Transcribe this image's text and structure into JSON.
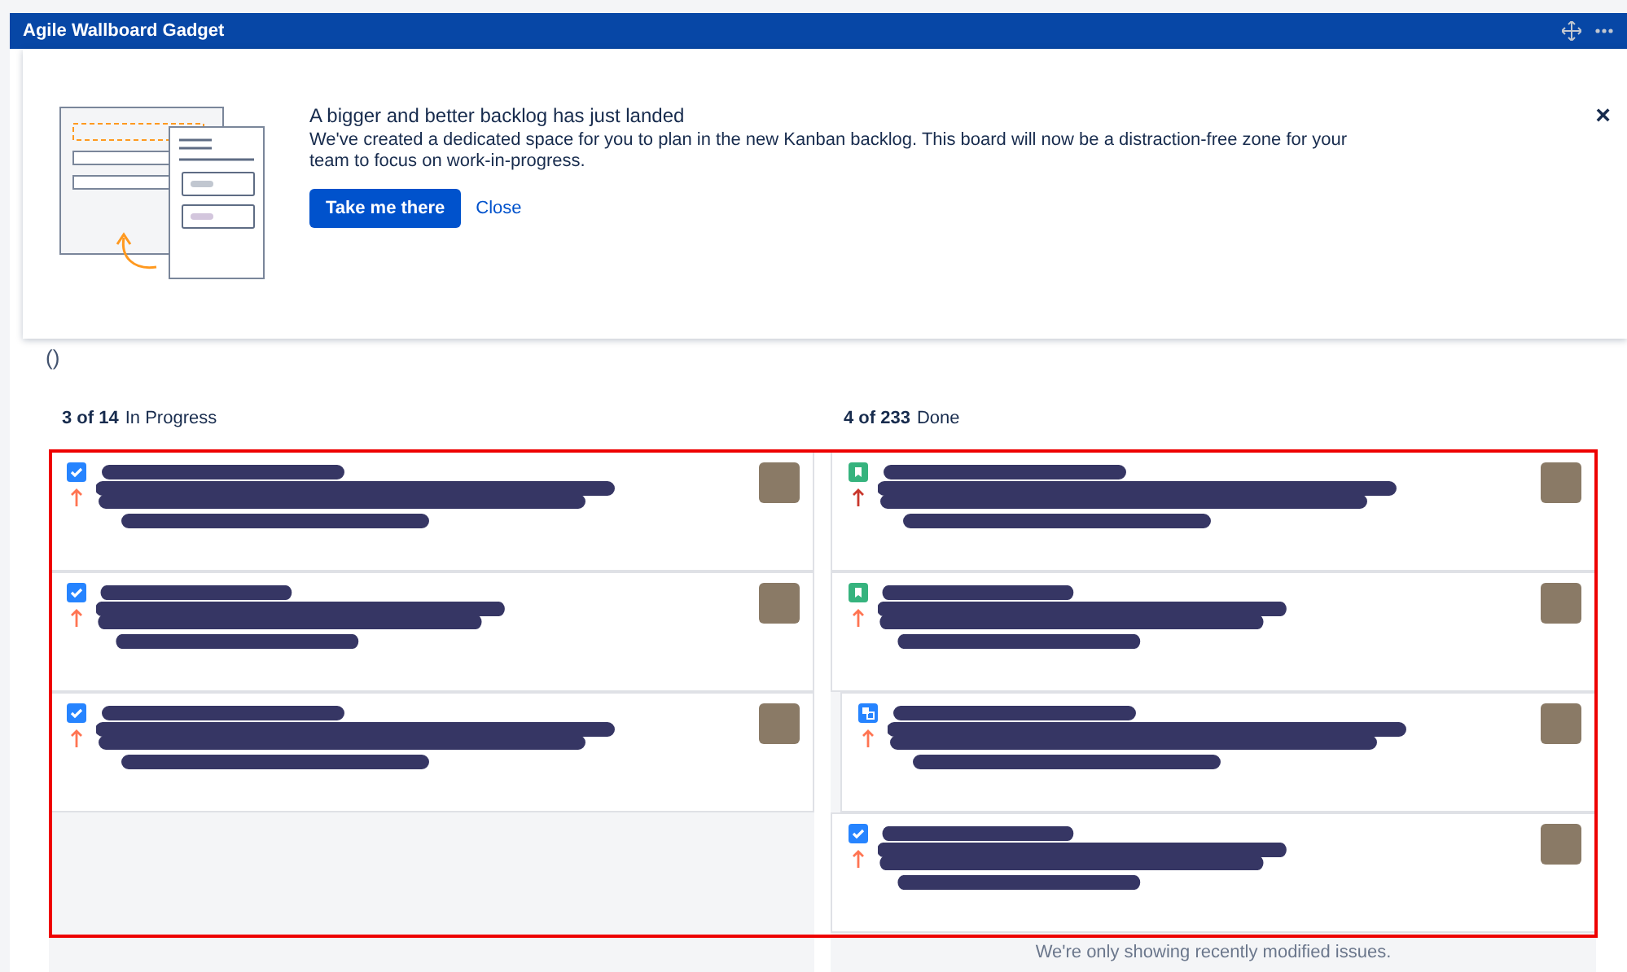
{
  "gadget": {
    "title": "Agile Wallboard Gadget"
  },
  "banner": {
    "heading": "A bigger and better backlog has just landed",
    "body": "We've created a dedicated space for you to plan in the new Kanban backlog. This board will now be a distraction-free zone for your team to focus on work-in-progress.",
    "primary_button": "Take me there",
    "link": "Close",
    "close_glyph": "×"
  },
  "board_title": "()",
  "columns": [
    {
      "count": "3 of 14",
      "name": "In Progress",
      "cards": [
        {
          "kind": "task",
          "color": "#ff7452"
        },
        {
          "kind": "task",
          "color": "#ff7452"
        },
        {
          "kind": "task",
          "color": "#ff7452"
        }
      ]
    },
    {
      "count": "4 of 233",
      "name": "Done",
      "footer": "We're only showing recently modified issues.",
      "cards": [
        {
          "kind": "story",
          "color": "#c9372c"
        },
        {
          "kind": "story",
          "color": "#ff7452"
        },
        {
          "kind": "subtask",
          "color": "#ff7452"
        },
        {
          "kind": "task",
          "color": "#ff7452"
        }
      ]
    }
  ]
}
